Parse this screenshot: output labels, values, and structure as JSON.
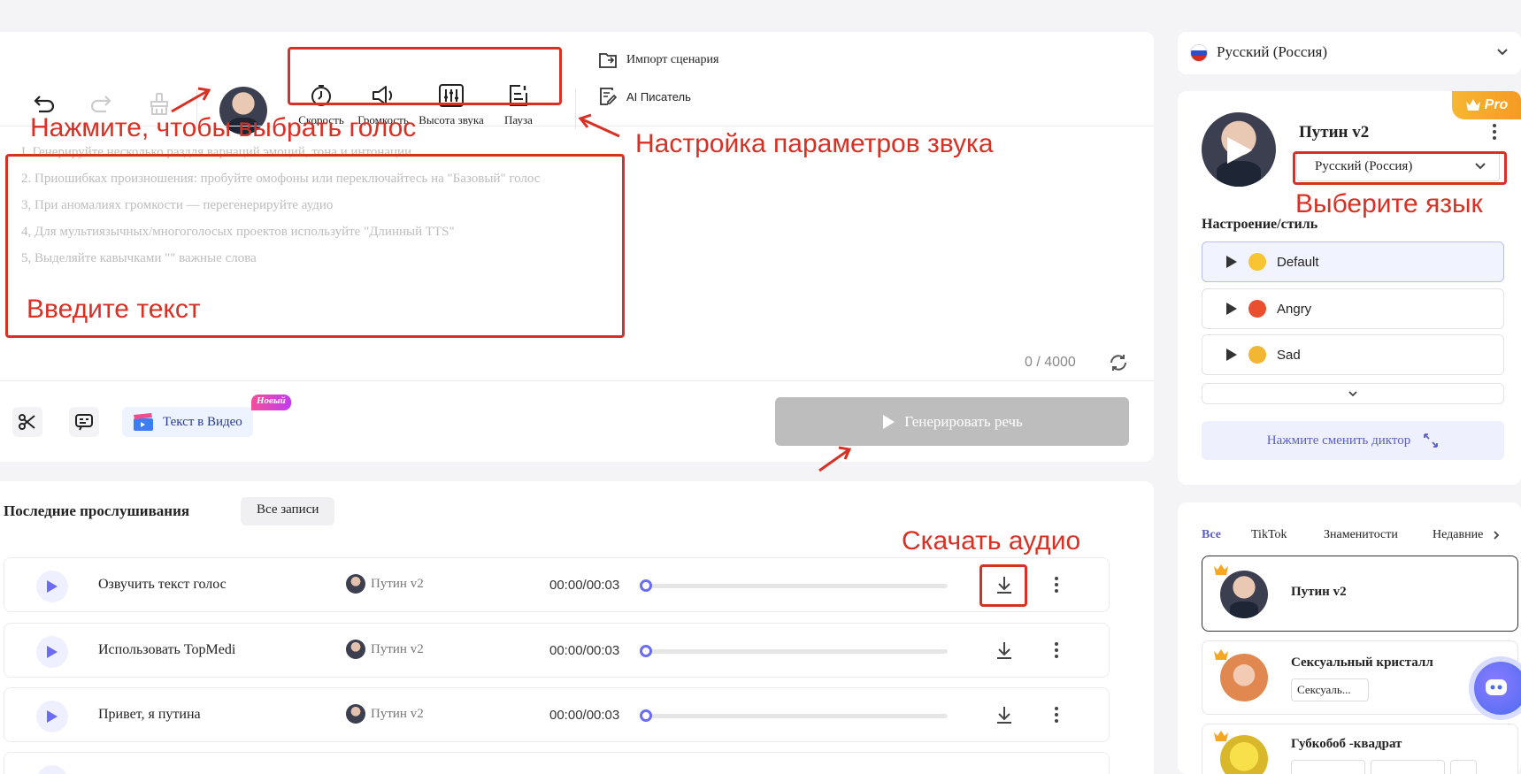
{
  "colors": {
    "accent": "#6a6cf5",
    "annotation": "#d93025",
    "generate_disabled": "#bdbdbd",
    "pro_badge": "#f5a623",
    "new_badge": "#e83e8c"
  },
  "toolbar": {
    "undo_icon": "undo-icon",
    "redo_icon": "redo-icon",
    "clear_icon": "broom-icon",
    "params": [
      {
        "label": "Скорость",
        "icon": "speed-icon"
      },
      {
        "label": "Громкость",
        "icon": "volume-icon"
      },
      {
        "label": "Высота звука",
        "icon": "pitch-icon"
      },
      {
        "label": "Пауза",
        "icon": "pause-icon"
      }
    ],
    "import_label": "Импорт сценария",
    "ai_writer_label": "AI Писатель"
  },
  "editor": {
    "hints": [
      "I. Генерируйте несколько раздля варнаций эмоций, тона и интонации",
      "2. Приошибках произношения: пробуйте омофоны или переключайтесь на \"Базовый\" голос",
      "3, При аномалиях громкости — перегенерируйте аудио",
      "4, Для мультиязычных/многоголосых проектов используйте \"Длинный TTS\"",
      "5, Выделяйте кавычками \"\" важные слова"
    ],
    "counter": "0 / 4000",
    "text_to_video_label": "Текст в Видео",
    "new_badge": "Новый",
    "generate_label": "Генерировать речь"
  },
  "annotations": {
    "choose_voice": "Нажмите, чтобы выбрать голос",
    "sound_settings": "Настройка параметров звука",
    "enter_text": "Введите текст",
    "choose_language": "Выберите язык",
    "download_audio": "Скачать аудио"
  },
  "recent": {
    "title": "Последние прослушивания",
    "all_records": "Все записи",
    "rows": [
      {
        "title": "Озвучить текст голос",
        "voice": "Путин v2",
        "time": "00:00/00:03",
        "progress": 0
      },
      {
        "title": "Использовать TopMedi",
        "voice": "Путин v2",
        "time": "00:00/00:03",
        "progress": 0
      },
      {
        "title": "Привет, я путина",
        "voice": "Путин v2",
        "time": "00:00/00:03",
        "progress": 0
      }
    ]
  },
  "right": {
    "language": "Русский (Россия)",
    "pro_badge": "Pro",
    "voice_name": "Путин v2",
    "voice_language": "Русский (Россия)",
    "mood_title": "Настроение/стиль",
    "moods": [
      {
        "label": "Default",
        "emoji_color": "#f7c531"
      },
      {
        "label": "Angry",
        "emoji_color": "#e8502f"
      },
      {
        "label": "Sad",
        "emoji_color": "#f2b632"
      }
    ],
    "change_speaker": "Нажмите сменить диктор",
    "filter_tabs": [
      "Все",
      "TikTok",
      "Знаменитости",
      "Недавние"
    ],
    "voices": [
      {
        "name": "Путин v2",
        "tags": []
      },
      {
        "name": "Сексуальный кристалл",
        "tags": [
          "Сексуаль..."
        ]
      },
      {
        "name": "Губкобоб -квадрат",
        "tags": []
      }
    ]
  }
}
